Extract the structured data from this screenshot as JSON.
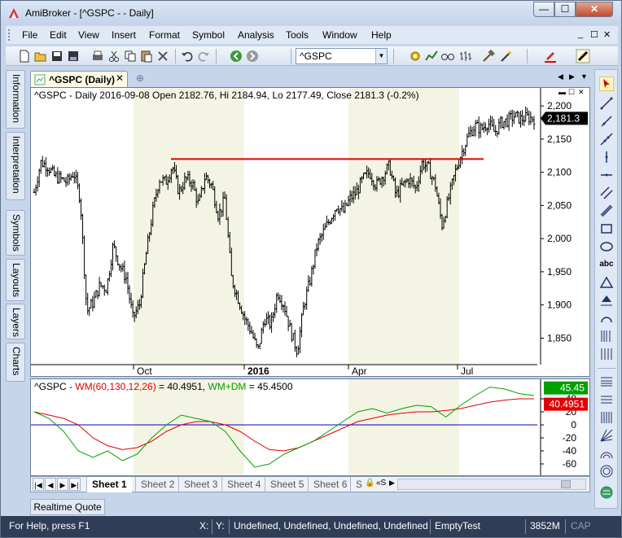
{
  "window": {
    "title": "AmiBroker - [^GSPC -  - Daily]",
    "close_glyph": "✕",
    "max_glyph": "☐",
    "min_glyph": "—"
  },
  "menu": {
    "items": [
      "File",
      "Edit",
      "View",
      "Insert",
      "Format",
      "Symbol",
      "Analysis",
      "Tools",
      "Window",
      "Help"
    ],
    "mdi_controls": [
      "_",
      "☐",
      "✕"
    ]
  },
  "toolbar": {
    "symbol_value": "^GSPC",
    "icons": [
      "new-icon",
      "open-icon",
      "save-icon",
      "save-all-icon",
      "print-icon",
      "cut-icon",
      "copy-icon",
      "paste-icon",
      "delete-icon",
      "undo-icon",
      "redo-icon",
      "back-icon",
      "forward-icon",
      "formula-icon",
      "analysis-icon",
      "glasses-icon",
      "bars-icon",
      "hammer-icon",
      "wand-icon",
      "color-icon",
      "pen-icon"
    ]
  },
  "side_tabs": [
    "Information",
    "Interpretation",
    "Symbols",
    "Layouts",
    "Layers",
    "Charts"
  ],
  "doc_tab": {
    "label": "^GSPC (Daily)",
    "close": "✕",
    "new": "⊕"
  },
  "doc_nav": [
    "◀",
    "▶",
    "▼"
  ],
  "price_pane": {
    "title": "^GSPC - Daily 2016-09-08 Open 2182.76, Hi 2184.94, Lo 2177.49, Close 2181.3 (-0.2%)",
    "last_price_label": "2,181.3",
    "y_ticks": [
      "2,200",
      "2,150",
      "2,100",
      "2,050",
      "2,000",
      "1,950",
      "1,900",
      "1,850"
    ],
    "y_tick_values": [
      2200,
      2150,
      2100,
      2050,
      2000,
      1950,
      1900,
      1850
    ],
    "x_labels": [
      "Oct",
      "2016",
      "Apr",
      "Jul"
    ],
    "resistance_level": 2120,
    "colors": {
      "bars": "#000000",
      "resistance": "#e00000",
      "shade": "#f4f4e4"
    }
  },
  "indicator_pane": {
    "title_prefix": "^GSPC - ",
    "wm_label": "WM(60,130,12,26)",
    "wm_value": " = 40.4951, ",
    "wmdm_label": "WM+DM",
    "wmdm_value": " = 45.4500",
    "wmdm_box": "45.45",
    "wm_box": "40.4951",
    "y_ticks": [
      "40",
      "20",
      "0",
      "-20",
      "-40",
      "-60"
    ],
    "y_tick_values": [
      40,
      20,
      0,
      -20,
      -40,
      -60
    ],
    "colors": {
      "wm": "#e00000",
      "wmdm": "#00a000",
      "zero": "#0000c0"
    }
  },
  "chart_data": [
    {
      "type": "ohlc",
      "title": "^GSPC - Daily 2016-09-08 Open 2182.76, Hi 2184.94, Lo 2177.49, Close 2181.3 (-0.2%)",
      "x_labels": [
        "Oct",
        "2016",
        "Apr",
        "Jul"
      ],
      "ylim": [
        1810,
        2210
      ],
      "last": {
        "date": "2016-09-08",
        "open": 2182.76,
        "high": 2184.94,
        "low": 2177.49,
        "close": 2181.3
      },
      "approx_close_path": [
        2070,
        2115,
        2110,
        2095,
        2090,
        2085,
        2100,
        2060,
        1890,
        1905,
        1930,
        1925,
        1990,
        1960,
        1940,
        1880,
        1900,
        1975,
        2040,
        2090,
        2085,
        2110,
        2070,
        2090,
        2085,
        2050,
        2095,
        2080,
        2035,
        2060,
        1940,
        1910,
        1880,
        1860,
        1830,
        1880,
        1870,
        1920,
        1900,
        1860,
        1830,
        1900,
        1940,
        1990,
        2010,
        2030,
        2050,
        2040,
        2060,
        2070,
        2090,
        2100,
        2080,
        2095,
        2110,
        2065,
        2080,
        2090,
        2075,
        2115,
        2105,
        2080,
        2020,
        2060,
        2100,
        2130,
        2155,
        2170,
        2165,
        2175,
        2160,
        2175,
        2178,
        2185,
        2180,
        2183,
        2181
      ],
      "horizontal_line": 2120
    },
    {
      "type": "line",
      "series": [
        {
          "name": "WM(60,130,12,26)",
          "last": 40.4951,
          "values": [
            20,
            15,
            10,
            0,
            -20,
            -32,
            -38,
            -35,
            -25,
            -10,
            0,
            5,
            5,
            0,
            -10,
            -25,
            -38,
            -40,
            -35,
            -25,
            -15,
            -5,
            5,
            10,
            15,
            18,
            20,
            20,
            22,
            25,
            30,
            35,
            38,
            40,
            40
          ]
        },
        {
          "name": "WM+DM",
          "last": 45.45,
          "values": [
            20,
            10,
            -10,
            -40,
            -50,
            -40,
            -55,
            -45,
            -20,
            0,
            15,
            10,
            5,
            -10,
            -40,
            -65,
            -60,
            -45,
            -35,
            -25,
            -10,
            5,
            20,
            25,
            18,
            25,
            30,
            28,
            12,
            30,
            45,
            58,
            55,
            48,
            45
          ]
        }
      ],
      "ylim": [
        -75,
        60
      ],
      "y_ticks": [
        40,
        20,
        0,
        -20,
        -40,
        -60
      ]
    }
  ],
  "sheets": {
    "nav": [
      "|◀",
      "◀",
      "▶",
      "▶|"
    ],
    "tabs": [
      "Sheet 1",
      "Sheet 2",
      "Sheet 3",
      "Sheet 4",
      "Sheet 5",
      "Sheet 6",
      "S"
    ],
    "active": "Sheet 1",
    "extra": [
      "🔒",
      "«S",
      "▶"
    ]
  },
  "realtime_tab": "Realtime Quote",
  "status": {
    "help": "For Help, press F1",
    "x": "X:",
    "y": "Y:",
    "info": "Undefined, Undefined, Undefined, Undefined",
    "db": "EmptyTest",
    "mem": "3852M",
    "cap": "CAP"
  }
}
